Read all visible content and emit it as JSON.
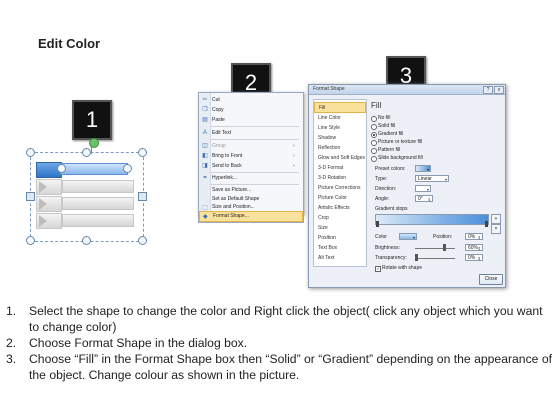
{
  "title": "Edit Color",
  "steps_markers": [
    "1",
    "2",
    "3"
  ],
  "context_menu": {
    "items": [
      {
        "icon": "scissors-icon",
        "glyph": "✂",
        "label": "Cut",
        "disabled": false,
        "arrow": ""
      },
      {
        "icon": "copy-icon",
        "glyph": "❐",
        "label": "Copy",
        "disabled": false,
        "arrow": ""
      },
      {
        "icon": "paste-icon",
        "glyph": "▤",
        "label": "Paste",
        "disabled": false,
        "arrow": ""
      },
      {
        "icon": "edit-text-icon",
        "glyph": "A",
        "label": "Edit Text",
        "disabled": false,
        "arrow": ""
      },
      {
        "icon": "group-icon",
        "glyph": "◫",
        "label": "Group",
        "disabled": true,
        "arrow": "›"
      },
      {
        "icon": "bring-front-icon",
        "glyph": "◧",
        "label": "Bring to Front",
        "disabled": false,
        "arrow": "›"
      },
      {
        "icon": "send-back-icon",
        "glyph": "◨",
        "label": "Send to Back",
        "disabled": false,
        "arrow": "›"
      },
      {
        "icon": "hyperlink-icon",
        "glyph": "⚭",
        "label": "Hyperlink...",
        "disabled": false,
        "arrow": ""
      },
      {
        "icon": "",
        "glyph": "",
        "label": "Save as Picture...",
        "disabled": false,
        "arrow": ""
      },
      {
        "icon": "",
        "glyph": "",
        "label": "Set as Default Shape",
        "disabled": false,
        "arrow": ""
      },
      {
        "icon": "size-position-icon",
        "glyph": "⬚",
        "label": "Size and Position...",
        "disabled": false,
        "arrow": ""
      },
      {
        "icon": "format-shape-icon",
        "glyph": "◆",
        "label": "Format Shape...",
        "disabled": false,
        "arrow": "",
        "highlight": true
      }
    ]
  },
  "dialog": {
    "title": "Format Shape",
    "help": "?",
    "close_x": "x",
    "categories": [
      "Fill",
      "Line Color",
      "Line Style",
      "Shadow",
      "Reflection",
      "Glow and Soft Edges",
      "3-D Format",
      "3-D Rotation",
      "Picture Corrections",
      "Picture Color",
      "Artistic Effects",
      "Crop",
      "Size",
      "Position",
      "Text Box",
      "Alt Text"
    ],
    "active_category": "Fill",
    "panel_heading": "Fill",
    "fill_options": [
      {
        "label": "No fill",
        "type": "radio",
        "checked": false
      },
      {
        "label": "Solid fill",
        "type": "radio",
        "checked": false
      },
      {
        "label": "Gradient fill",
        "type": "radio",
        "checked": true
      },
      {
        "label": "Picture or texture fill",
        "type": "radio",
        "checked": false
      },
      {
        "label": "Pattern fill",
        "type": "radio",
        "checked": false
      },
      {
        "label": "Slide background fill",
        "type": "radio",
        "checked": false
      }
    ],
    "preset_colors_label": "Preset colors:",
    "type_label": "Type:",
    "type_value": "Linear",
    "direction_label": "Direction:",
    "angle_label": "Angle:",
    "angle_value": "0°",
    "gradient_stops_label": "Gradient stops",
    "color_label": "Color",
    "position_label": "Position:",
    "position_value": "0%",
    "brightness_label": "Brightness:",
    "brightness_value": "60%",
    "transparency_label": "Transparency:",
    "transparency_value": "0%",
    "rotate_label": "Rotate with shape",
    "rotate_checked": true,
    "close_button": "Close"
  },
  "instructions": [
    {
      "num": "1.",
      "text": "Select the shape to change the color and Right click the object( click any object which you want to change color)"
    },
    {
      "num": "2.",
      "text": "Choose Format Shape in the dialog box."
    },
    {
      "num": "3.",
      "text": "Choose “Fill” in the Format Shape box then “Solid” or “Gradient” depending on the appearance of the object. Change colour as shown in the picture."
    }
  ],
  "colors": {
    "highlight": "#fbe29c",
    "selected_row": "#8ab8ea",
    "marker": "#111111"
  }
}
